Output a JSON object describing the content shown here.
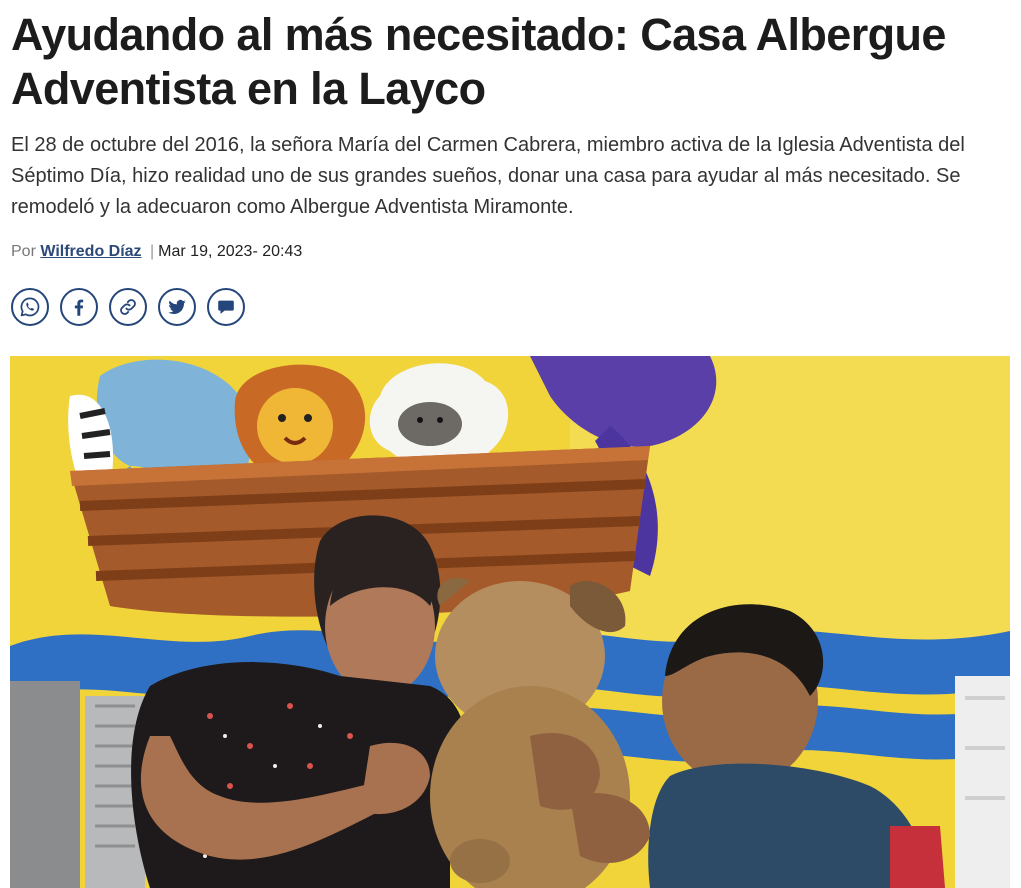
{
  "article": {
    "headline": "Ayudando al más necesitado: Casa Albergue Adventista en la Layco",
    "lead": "El 28 de octubre del 2016, la señora María del Carmen Cabrera, miembro activa de la Iglesia Adventista del Séptimo Día, hizo realidad uno de sus grandes sueños, donar una casa para ayudar al más necesitado. Se remodeló y la adecuaron como Albergue Adventista Miramonte.",
    "byline": {
      "prefix": "Por",
      "author": "Wilfredo Díaz",
      "separator": "|",
      "date": "Mar 19, 2023- 20:43"
    },
    "share": {
      "accent_color": "#25467a",
      "icons": [
        "whatsapp-icon",
        "facebook-icon",
        "link-icon",
        "twitter-icon",
        "comment-icon"
      ]
    }
  }
}
